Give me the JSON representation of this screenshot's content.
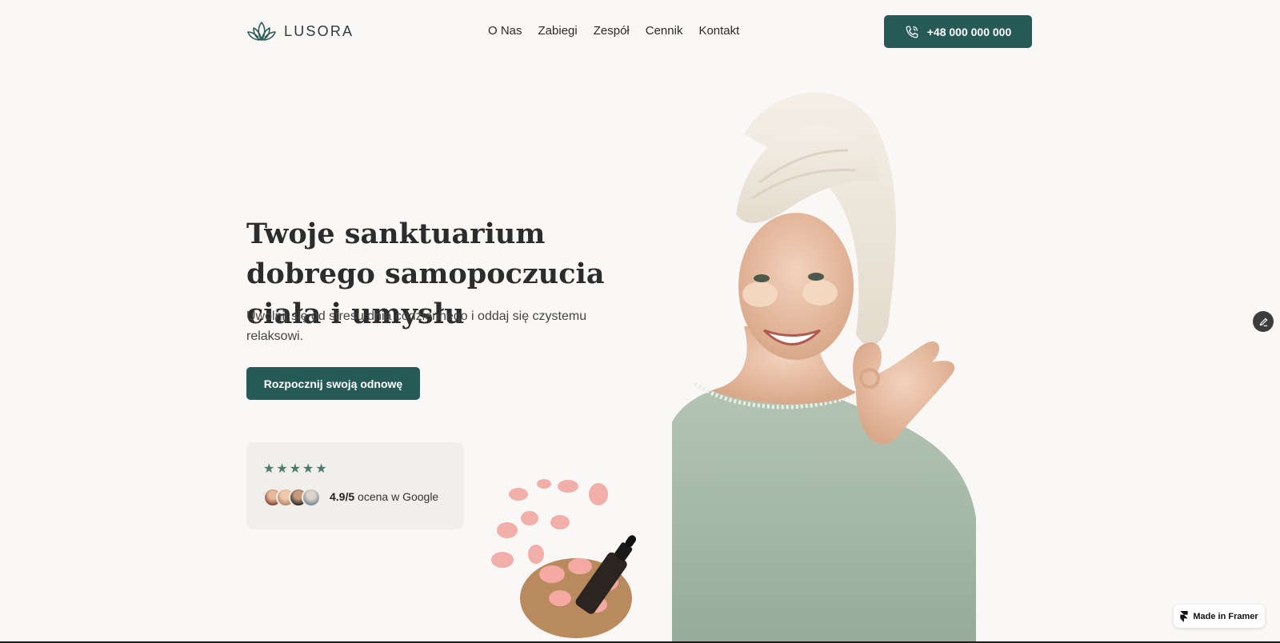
{
  "header": {
    "logo_text": "LUSORA",
    "nav": [
      "O Nas",
      "Zabiegi",
      "Zespół",
      "Cennik",
      "Kontakt"
    ],
    "phone_label": "+48 000 000 000"
  },
  "hero": {
    "title": "Twoje sanktuarium dobrego samopoczucia ciała i umysłu",
    "subtitle": "Uwolnij się od stresu dnia codziennego i oddaj się czystemu relaksowi.",
    "cta_label": "Rozpocznij swoją odnowę"
  },
  "rating": {
    "stars": 5,
    "score": "4.9/5",
    "text": "ocena w Google"
  },
  "badge": {
    "label": "Made in Framer"
  },
  "colors": {
    "accent": "#255a57",
    "background": "#f9f8f6",
    "card": "#f0efeb",
    "star": "#4e7a6e"
  },
  "icons": [
    "lotus-logo-icon",
    "phone-icon",
    "star-icon",
    "edit-pencil-icon",
    "framer-icon"
  ]
}
